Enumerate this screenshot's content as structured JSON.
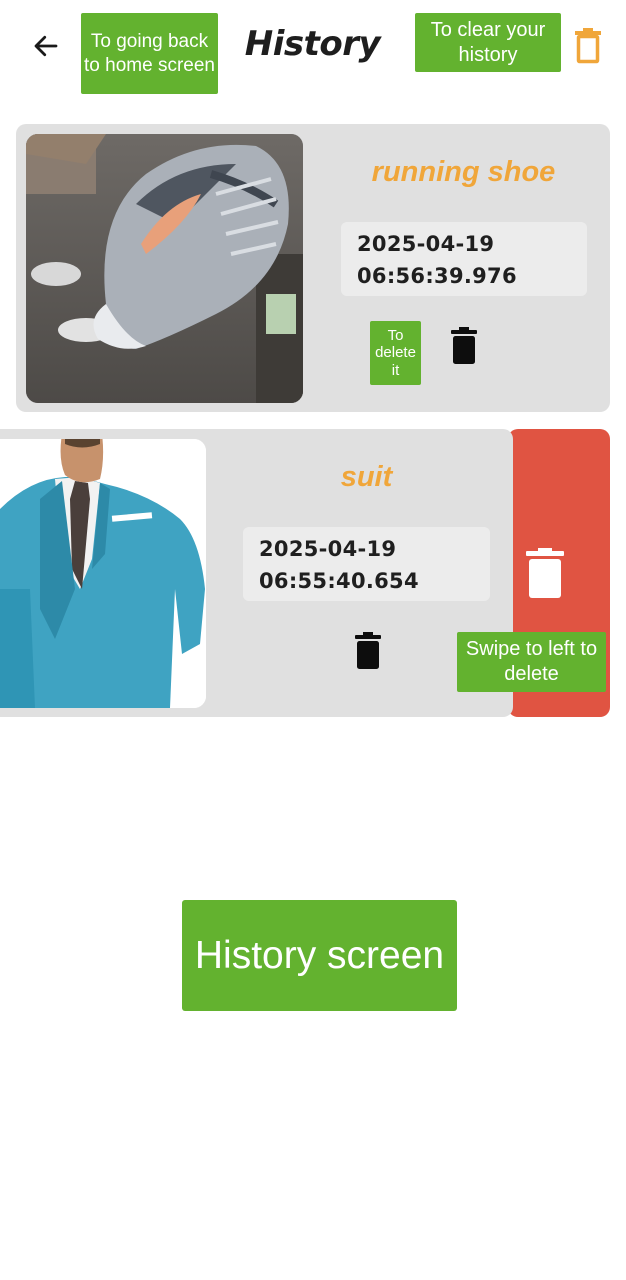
{
  "header": {
    "title": "History",
    "back_icon": "arrow-left-icon",
    "clear_icon": "trash-outline-icon",
    "accent": "#f0a63a"
  },
  "annotations": {
    "back": "To going back to home screen",
    "clear": "To clear your history",
    "delete": "To delete it",
    "swipe": "Swipe to left to delete",
    "screen": "History screen",
    "color": "#63b22f"
  },
  "items": [
    {
      "title": "running shoe",
      "timestamp": "2025-04-19\n06:56:39.976",
      "image": "running shoe photo",
      "delete_icon": "trash-icon"
    },
    {
      "title": "suit",
      "timestamp": "2025-04-19\n06:55:40.654",
      "image": "blue suit photo",
      "delete_icon": "trash-icon",
      "swipe_action_icon": "trash-icon",
      "swipe_action_color": "#e05442"
    }
  ]
}
